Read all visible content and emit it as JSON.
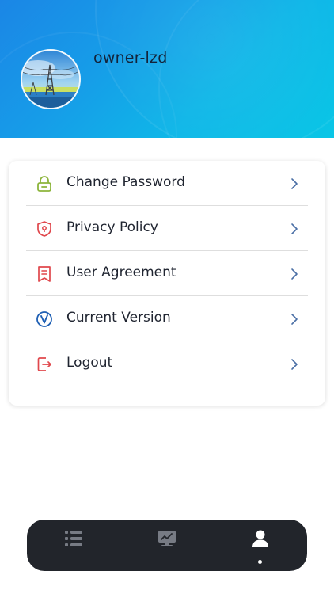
{
  "profile": {
    "username": "owner-lzd",
    "avatar_icon": "avatar-power-tower-image"
  },
  "menu": {
    "items": [
      {
        "label": "Change Password",
        "icon": "lock-icon",
        "color": "#8db53c"
      },
      {
        "label": "Privacy Policy",
        "icon": "shield-icon",
        "color": "#e0474c"
      },
      {
        "label": "User Agreement",
        "icon": "document-icon",
        "color": "#e0474c"
      },
      {
        "label": "Current Version",
        "icon": "version-v-icon",
        "color": "#1e5fb4"
      },
      {
        "label": "Logout",
        "icon": "logout-icon",
        "color": "#e0474c"
      }
    ],
    "chevron_icon": "chevron-right-icon",
    "chevron_color": "#4a6fa5"
  },
  "bottom_nav": {
    "tabs": [
      {
        "icon": "list-icon",
        "active": false
      },
      {
        "icon": "chart-icon",
        "active": false
      },
      {
        "icon": "user-icon",
        "active": true
      }
    ],
    "background": "#22252b",
    "inactive_color": "#777b84",
    "active_color": "#ffffff"
  },
  "colors": {
    "header_gradient_start": "#1b86e6",
    "header_gradient_end": "#0ac6e6"
  }
}
